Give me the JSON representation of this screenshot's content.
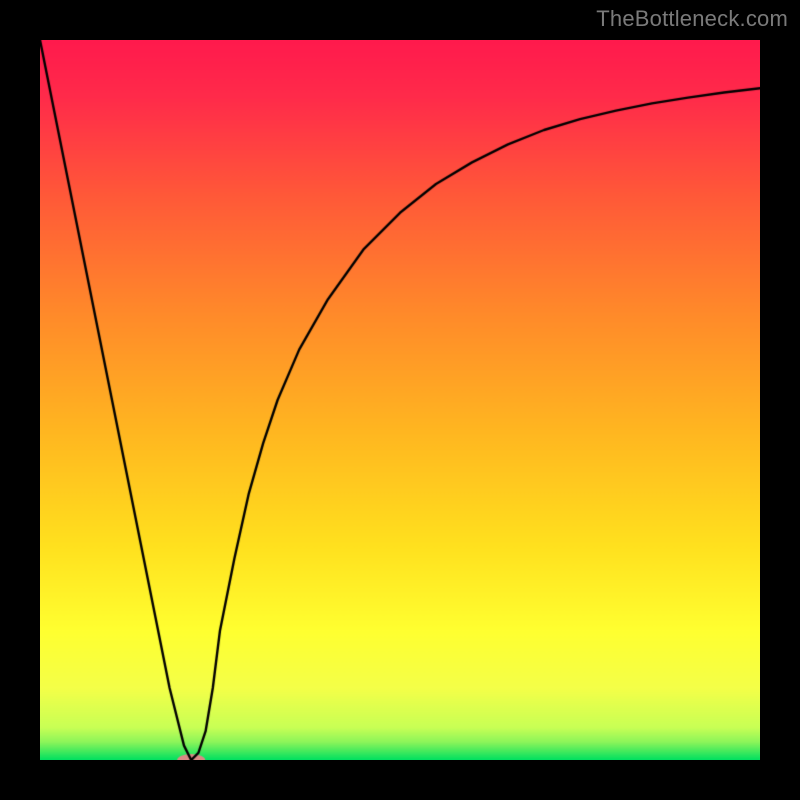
{
  "watermark": {
    "text": "TheBottleneck.com"
  },
  "chart_data": {
    "type": "line",
    "title": "",
    "xlabel": "",
    "ylabel": "",
    "xlim": [
      0,
      100
    ],
    "ylim": [
      0,
      100
    ],
    "grid": false,
    "legend": false,
    "background_gradient": {
      "top_color": "#ff1a4d",
      "mid_colors": [
        "#ff7a2a",
        "#ffd21f",
        "#ffff3a"
      ],
      "bottom_color": "#00e05a"
    },
    "series": [
      {
        "name": "curve",
        "color": "#000000",
        "x": [
          0,
          2,
          4,
          6,
          8,
          10,
          12,
          14,
          16,
          18,
          20,
          21,
          22,
          23,
          24,
          25,
          27,
          29,
          31,
          33,
          36,
          40,
          45,
          50,
          55,
          60,
          65,
          70,
          75,
          80,
          85,
          90,
          95,
          100
        ],
        "values": [
          100,
          90,
          80,
          70,
          60,
          50,
          40,
          30,
          20,
          10,
          2,
          0,
          1,
          4,
          10,
          18,
          28,
          37,
          44,
          50,
          57,
          64,
          71,
          76,
          80,
          83,
          85.5,
          87.5,
          89,
          90.2,
          91.2,
          92,
          92.7,
          93.3
        ]
      }
    ],
    "marker": {
      "name": "min-marker",
      "x": 21,
      "y": 0,
      "color": "#d98a85",
      "rx": 14,
      "ry": 6
    }
  }
}
